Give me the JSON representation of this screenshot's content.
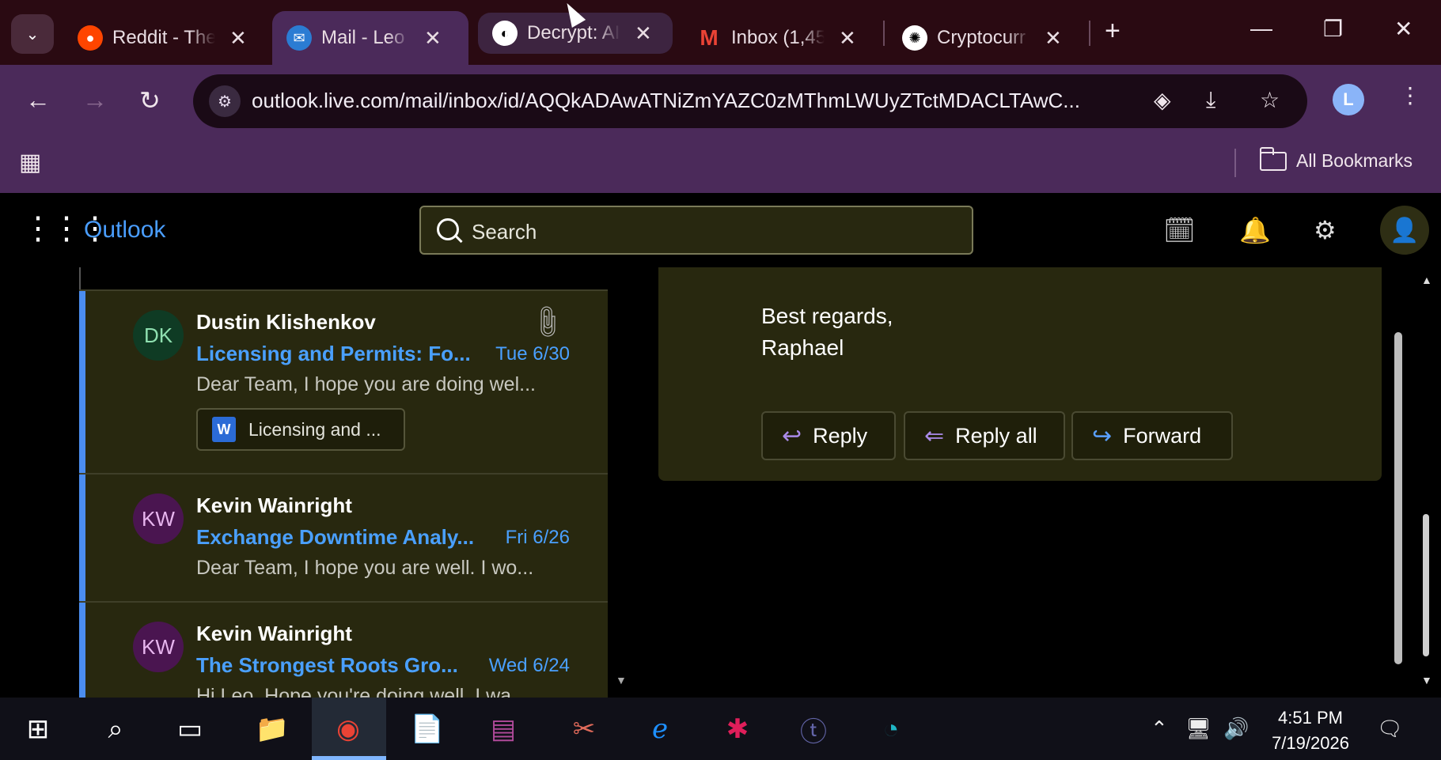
{
  "browser": {
    "tabs": [
      {
        "title": "Reddit - The",
        "favicon": "reddit-icon",
        "fav_color": "#ff4500",
        "fav_glyph": "●"
      },
      {
        "title": "Mail - Leo C",
        "favicon": "outlook-icon",
        "fav_color": "#2b7cd3",
        "fav_glyph": "✉"
      },
      {
        "title": "Decrypt: AI",
        "favicon": "decrypt-icon",
        "fav_color": "#ffffff",
        "fav_glyph": "◐"
      },
      {
        "title": "Inbox (1,45",
        "favicon": "gmail-icon",
        "fav_color": "#ea4335",
        "fav_glyph": "M"
      },
      {
        "title": "Cryptocurr",
        "favicon": "chatgpt-icon",
        "fav_color": "#ffffff",
        "fav_glyph": "✺"
      }
    ],
    "url": "outlook.live.com/mail/inbox/id/AQQkADAwATNiZmYAZC0zMThmLWUyZTctMDACLTAwC...",
    "profile_initial": "L",
    "bookmarks_label": "All Bookmarks"
  },
  "outlook": {
    "brand": "Outlook",
    "search_placeholder": "Search"
  },
  "messages": [
    {
      "initials": "DK",
      "avatar_bg": "#0f3b24",
      "avatar_fg": "#8fe0b0",
      "sender": "Dustin Klishenkov",
      "subject": "Licensing and Permits: Fo...",
      "date": "Tue 6/30",
      "preview": "Dear Team, I hope you are doing wel...",
      "attachment": "Licensing and ..."
    },
    {
      "initials": "KW",
      "avatar_bg": "#4a1550",
      "avatar_fg": "#e7b5ee",
      "sender": "Kevin Wainright",
      "subject": "Exchange Downtime Analy...",
      "date": "Fri 6/26",
      "preview": "Dear Team, I hope you are well. I wo..."
    },
    {
      "initials": "KW",
      "avatar_bg": "#4a1550",
      "avatar_fg": "#e7b5ee",
      "sender": "Kevin Wainright",
      "subject": "The Strongest Roots Gro...",
      "date": "Wed 6/24",
      "preview": "Hi Leo, Hope you're doing well. I wa..."
    }
  ],
  "reading": {
    "signoff_line1": "Best regards,",
    "signoff_line2": "Raphael",
    "reply_label": "Reply",
    "reply_all_label": "Reply all",
    "forward_label": "Forward"
  },
  "taskbar": {
    "time": "4:51 PM",
    "date": "7/19/2026"
  }
}
